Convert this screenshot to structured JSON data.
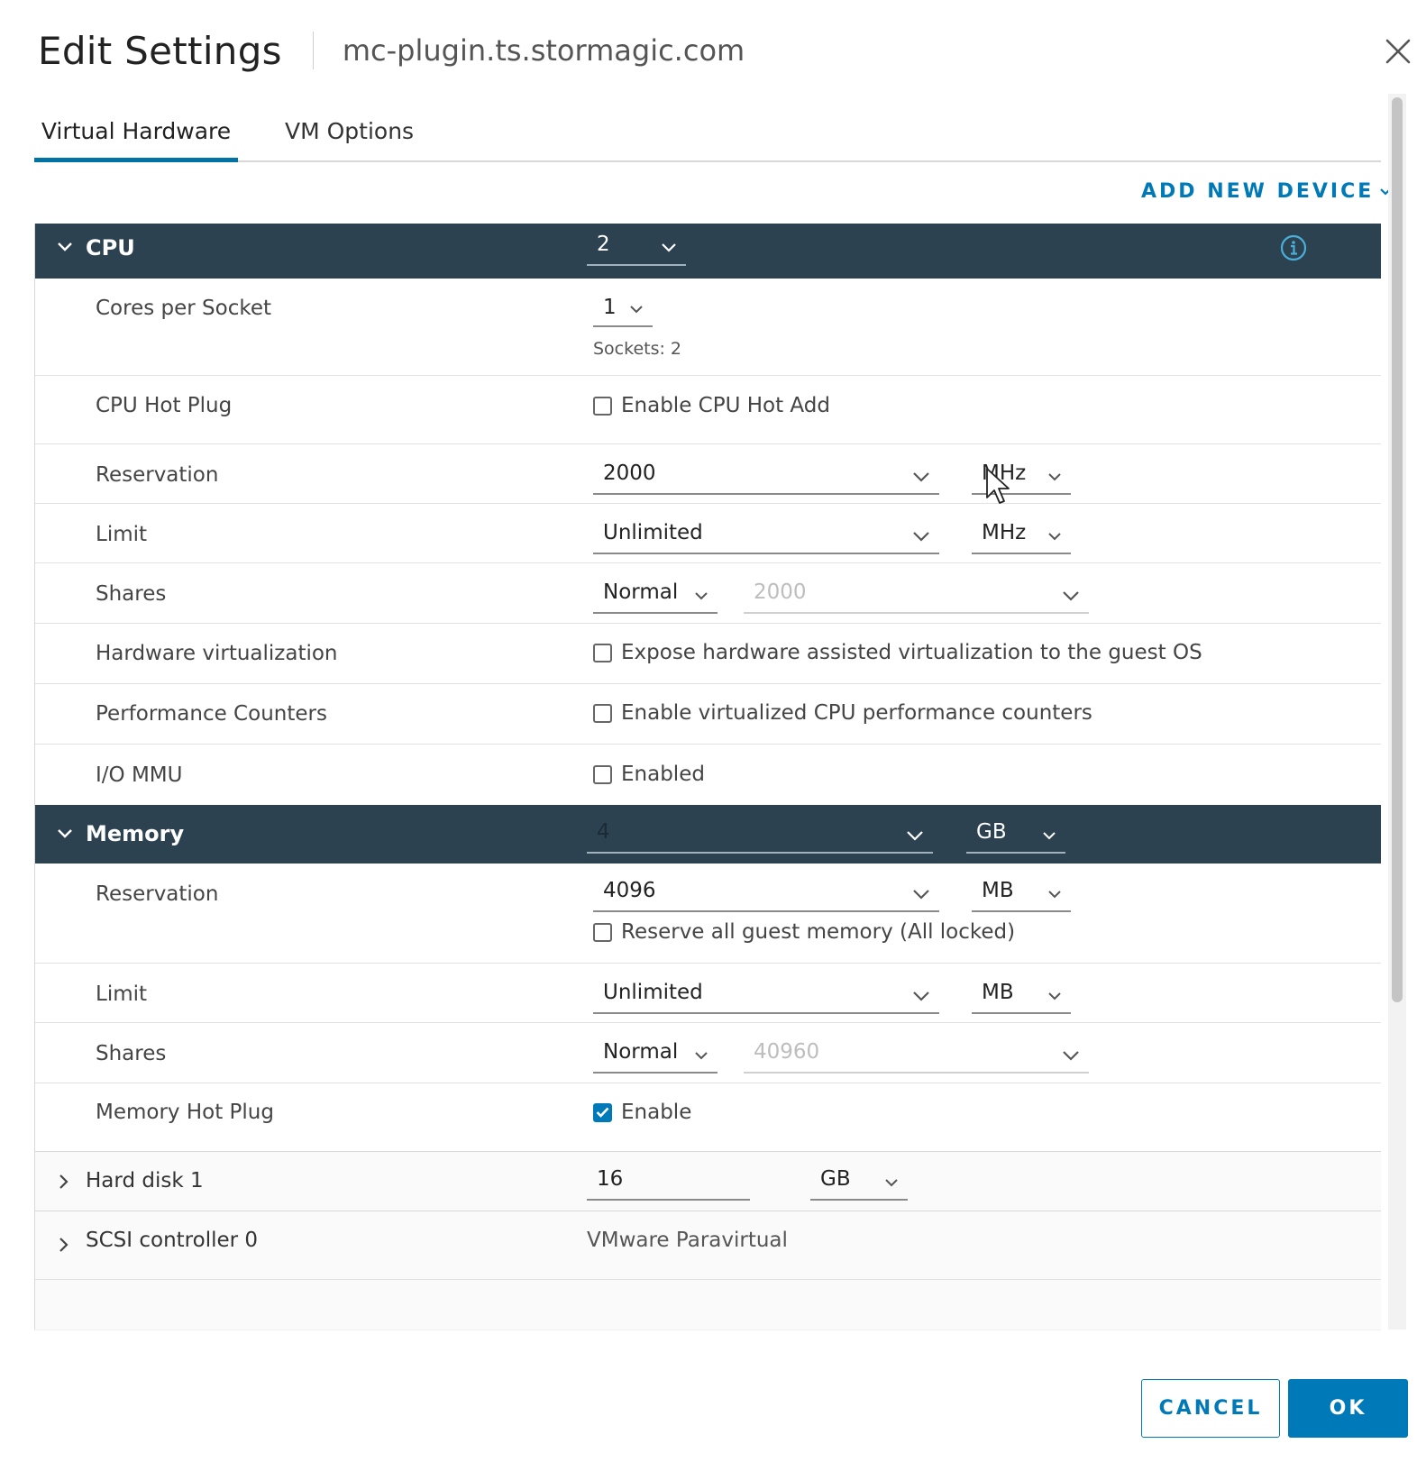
{
  "dialog": {
    "title": "Edit Settings",
    "subtitle": "mc-plugin.ts.stormagic.com"
  },
  "tabs": [
    {
      "label": "Virtual Hardware",
      "active": true
    },
    {
      "label": "VM Options",
      "active": false
    }
  ],
  "add_device": {
    "label": "ADD NEW DEVICE"
  },
  "cpu": {
    "title": "CPU",
    "value": "2",
    "cores_per_socket": {
      "label": "Cores per Socket",
      "value": "1",
      "helper": "Sockets: 2"
    },
    "hot_plug": {
      "label": "CPU Hot Plug",
      "checkbox": "Enable CPU Hot Add",
      "checked": false
    },
    "reservation": {
      "label": "Reservation",
      "value": "2000",
      "unit": "MHz"
    },
    "limit": {
      "label": "Limit",
      "value": "Unlimited",
      "unit": "MHz"
    },
    "shares": {
      "label": "Shares",
      "level": "Normal",
      "value": "2000"
    },
    "hw_virtualization": {
      "label": "Hardware virtualization",
      "checkbox": "Expose hardware assisted virtualization to the guest OS",
      "checked": false
    },
    "perf_counters": {
      "label": "Performance Counters",
      "checkbox": "Enable virtualized CPU performance counters",
      "checked": false
    },
    "io_mmu": {
      "label": "I/O MMU",
      "checkbox": "Enabled",
      "checked": false
    }
  },
  "memory": {
    "title": "Memory",
    "value": "4",
    "unit": "GB",
    "reservation": {
      "label": "Reservation",
      "value": "4096",
      "unit": "MB",
      "checkbox": "Reserve all guest memory (All locked)",
      "checked": false
    },
    "limit": {
      "label": "Limit",
      "value": "Unlimited",
      "unit": "MB"
    },
    "shares": {
      "label": "Shares",
      "level": "Normal",
      "value": "40960"
    },
    "hot_plug": {
      "label": "Memory Hot Plug",
      "checkbox": "Enable",
      "checked": true
    }
  },
  "hard_disk": {
    "label": "Hard disk 1",
    "value": "16",
    "unit": "GB"
  },
  "scsi": {
    "label": "SCSI controller 0",
    "value": "VMware Paravirtual"
  },
  "footer": {
    "cancel": "CANCEL",
    "ok": "OK"
  },
  "colors": {
    "accent": "#0079b8",
    "section_header": "#2d4251"
  },
  "icons": [
    "close-icon",
    "chevron-down-icon",
    "chevron-right-icon",
    "info-icon",
    "checkmark-icon",
    "mouse-cursor-icon"
  ]
}
